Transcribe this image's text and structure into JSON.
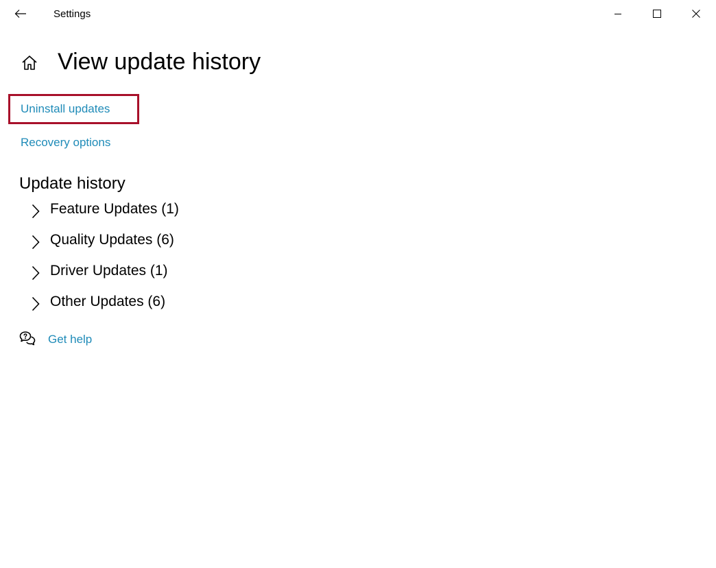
{
  "window": {
    "title": "Settings"
  },
  "header": {
    "title": "View update history"
  },
  "links": {
    "uninstall": "Uninstall updates",
    "recovery": "Recovery options",
    "help": "Get help"
  },
  "history": {
    "title": "Update history",
    "items": [
      {
        "label": "Feature Updates (1)"
      },
      {
        "label": "Quality Updates (6)"
      },
      {
        "label": "Driver Updates (1)"
      },
      {
        "label": "Other Updates (6)"
      }
    ]
  },
  "icons": {
    "back": "back-arrow-icon",
    "minimize": "minimize-icon",
    "maximize": "maximize-icon",
    "close": "close-icon",
    "home": "home-icon",
    "chevron": "chevron-right-icon",
    "help": "help-chat-icon"
  },
  "colors": {
    "link": "#1f8bb8",
    "highlight": "#a8102a",
    "text": "#000000",
    "background": "#ffffff"
  }
}
